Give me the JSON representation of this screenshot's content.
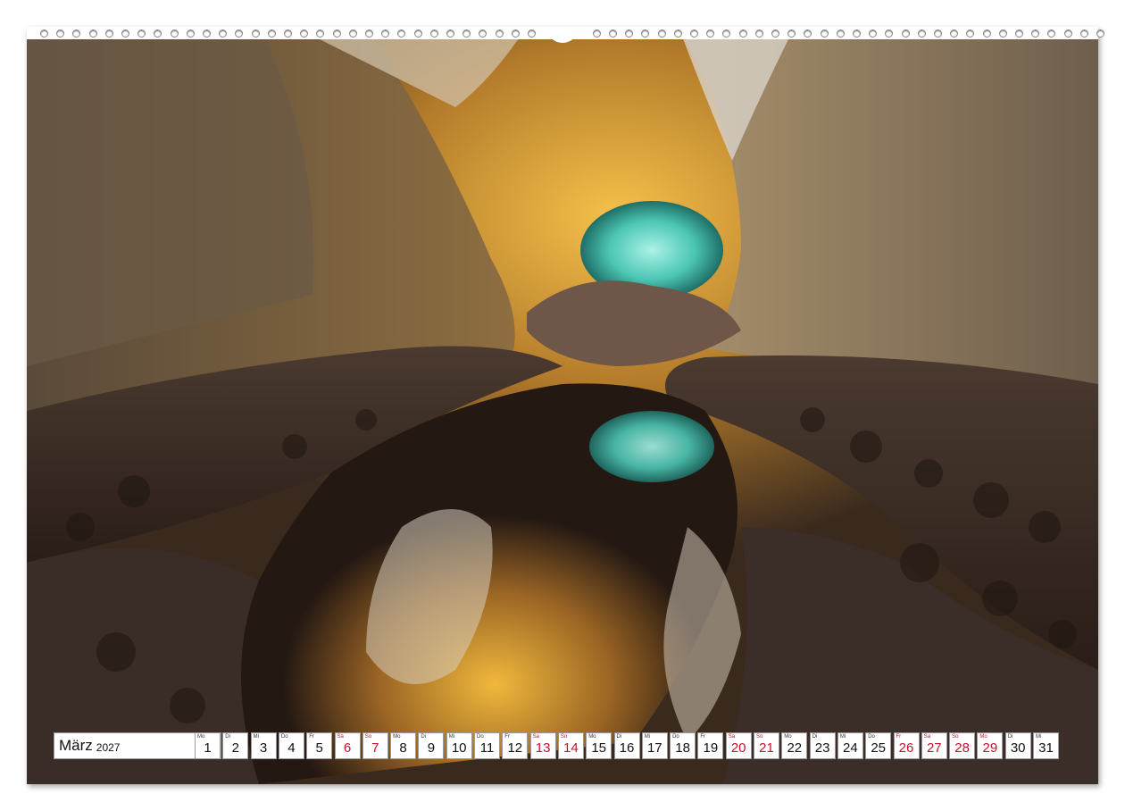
{
  "calendar": {
    "month": "März",
    "year": "2027",
    "days": [
      {
        "dow": "Mo",
        "num": "1",
        "weekend": false
      },
      {
        "dow": "Di",
        "num": "2",
        "weekend": false
      },
      {
        "dow": "Mi",
        "num": "3",
        "weekend": false
      },
      {
        "dow": "Do",
        "num": "4",
        "weekend": false
      },
      {
        "dow": "Fr",
        "num": "5",
        "weekend": false
      },
      {
        "dow": "Sa",
        "num": "6",
        "weekend": true
      },
      {
        "dow": "So",
        "num": "7",
        "weekend": true
      },
      {
        "dow": "Mo",
        "num": "8",
        "weekend": false
      },
      {
        "dow": "Di",
        "num": "9",
        "weekend": false
      },
      {
        "dow": "Mi",
        "num": "10",
        "weekend": false
      },
      {
        "dow": "Do",
        "num": "11",
        "weekend": false
      },
      {
        "dow": "Fr",
        "num": "12",
        "weekend": false
      },
      {
        "dow": "Sa",
        "num": "13",
        "weekend": true
      },
      {
        "dow": "So",
        "num": "14",
        "weekend": true
      },
      {
        "dow": "Mo",
        "num": "15",
        "weekend": false
      },
      {
        "dow": "Di",
        "num": "16",
        "weekend": false
      },
      {
        "dow": "Mi",
        "num": "17",
        "weekend": false
      },
      {
        "dow": "Do",
        "num": "18",
        "weekend": false
      },
      {
        "dow": "Fr",
        "num": "19",
        "weekend": false
      },
      {
        "dow": "Sa",
        "num": "20",
        "weekend": true
      },
      {
        "dow": "So",
        "num": "21",
        "weekend": true
      },
      {
        "dow": "Mo",
        "num": "22",
        "weekend": false
      },
      {
        "dow": "Di",
        "num": "23",
        "weekend": false
      },
      {
        "dow": "Mi",
        "num": "24",
        "weekend": false
      },
      {
        "dow": "Do",
        "num": "25",
        "weekend": false
      },
      {
        "dow": "Fr",
        "num": "26",
        "weekend": true
      },
      {
        "dow": "Sa",
        "num": "27",
        "weekend": true
      },
      {
        "dow": "So",
        "num": "28",
        "weekend": true
      },
      {
        "dow": "Mo",
        "num": "29",
        "weekend": true
      },
      {
        "dow": "Di",
        "num": "30",
        "weekend": false
      },
      {
        "dow": "Mi",
        "num": "31",
        "weekend": false
      }
    ]
  },
  "colors": {
    "weekend": "#c8102e",
    "cave_gold": "#d89a1e",
    "cave_turquoise": "#5ed6c8",
    "rock_dark": "#2a1d17"
  }
}
